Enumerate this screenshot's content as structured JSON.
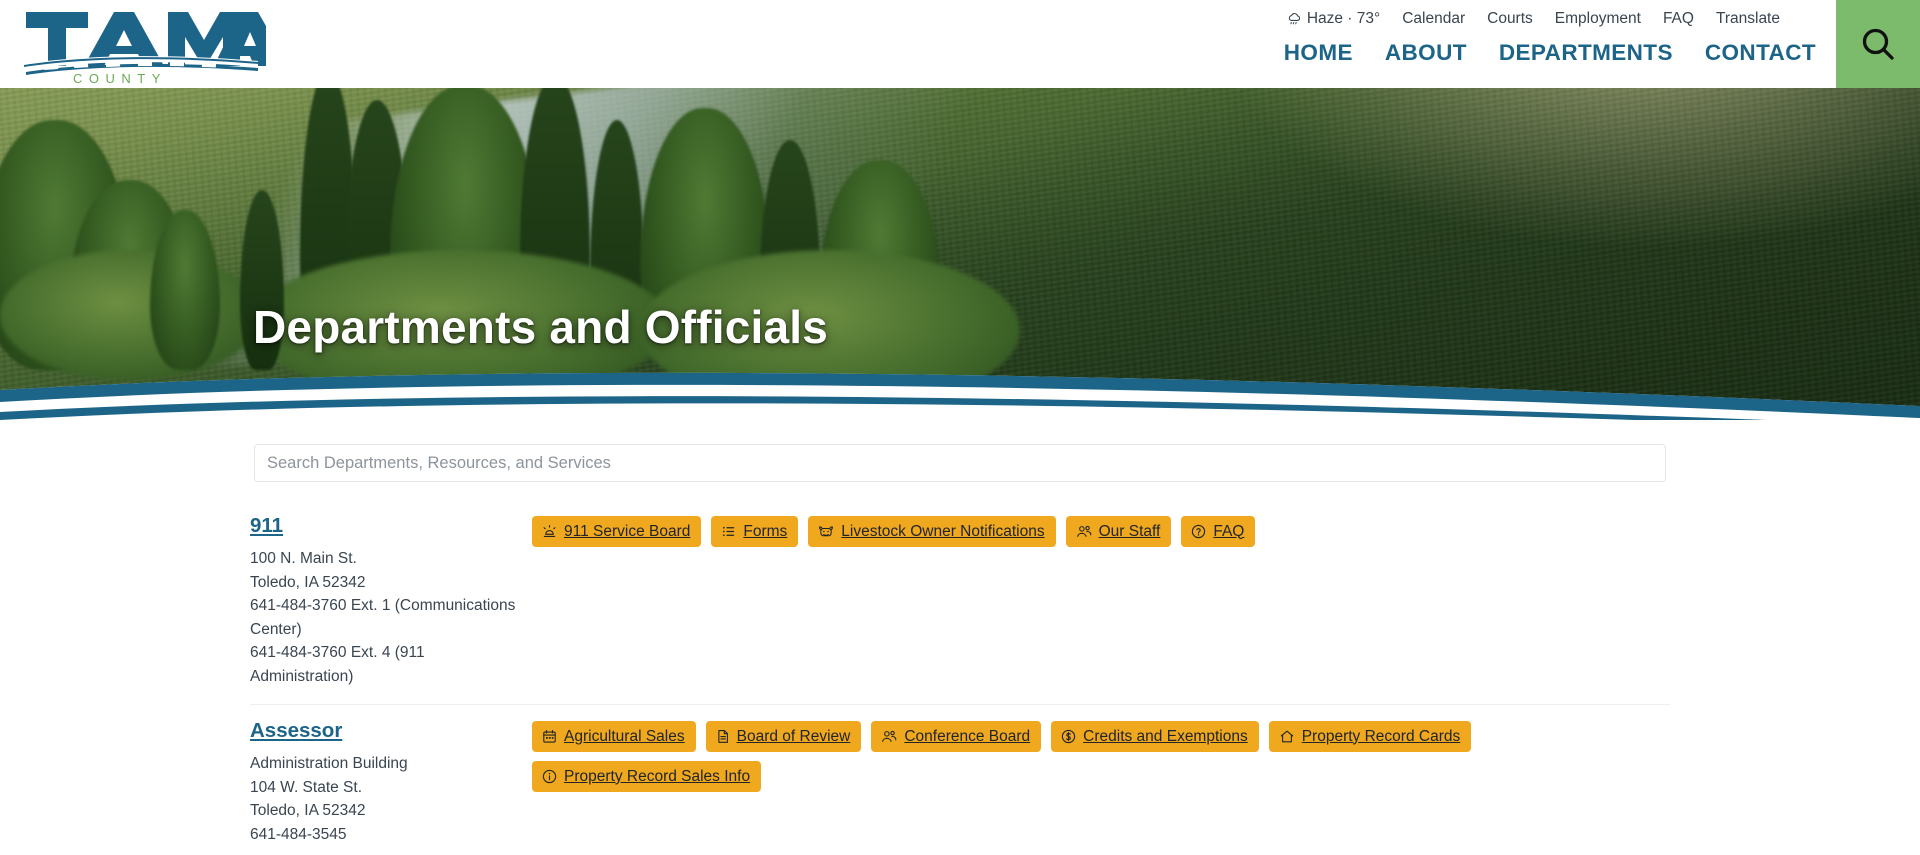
{
  "site": {
    "logo_primary": "TAMA",
    "logo_secondary": "C O U N T Y",
    "brand_blue": "#1d6489",
    "brand_green": "#7cbb6b",
    "badge_amber": "#f0a81e"
  },
  "topbar": {
    "weather_icon": "cloud-rain-icon",
    "weather": "Haze · 73°",
    "links": [
      {
        "label": "Calendar",
        "name": "toplink-calendar"
      },
      {
        "label": "Courts",
        "name": "toplink-courts"
      },
      {
        "label": "Employment",
        "name": "toplink-employment"
      },
      {
        "label": "FAQ",
        "name": "toplink-faq"
      },
      {
        "label": "Translate",
        "name": "toplink-translate"
      }
    ]
  },
  "mainnav": {
    "items": [
      {
        "label": "HOME",
        "name": "nav-home"
      },
      {
        "label": "ABOUT",
        "name": "nav-about"
      },
      {
        "label": "DEPARTMENTS",
        "name": "nav-departments"
      },
      {
        "label": "CONTACT",
        "name": "nav-contact"
      }
    ],
    "search_icon": "search-icon"
  },
  "hero": {
    "title": "Departments and Officials"
  },
  "search": {
    "placeholder": "Search Departments, Resources, and Services",
    "value": ""
  },
  "departments": [
    {
      "name": "911",
      "address": [
        "100 N. Main St.",
        "Toledo, IA 52342",
        "641-484-3760 Ext. 1 (Communications Center)",
        "641-484-3760 Ext. 4 (911 Administration)"
      ],
      "badges": [
        {
          "label": "911 Service Board",
          "icon": "siren-icon"
        },
        {
          "label": "Forms",
          "icon": "list-icon"
        },
        {
          "label": "Livestock Owner Notifications",
          "icon": "cow-icon"
        },
        {
          "label": "Our Staff",
          "icon": "people-icon"
        },
        {
          "label": "FAQ",
          "icon": "question-circle-icon"
        }
      ]
    },
    {
      "name": "Assessor",
      "address": [
        "Administration Building",
        "104 W. State St.",
        "Toledo, IA 52342",
        "641-484-3545"
      ],
      "badges": [
        {
          "label": "Agricultural Sales",
          "icon": "calendar-icon"
        },
        {
          "label": "Board of Review",
          "icon": "document-icon"
        },
        {
          "label": "Conference Board",
          "icon": "people-icon"
        },
        {
          "label": "Credits and Exemptions",
          "icon": "dollar-circle-icon"
        },
        {
          "label": "Property Record Cards",
          "icon": "home-icon"
        },
        {
          "label": "Property Record Sales Info",
          "icon": "info-circle-icon"
        }
      ]
    }
  ]
}
